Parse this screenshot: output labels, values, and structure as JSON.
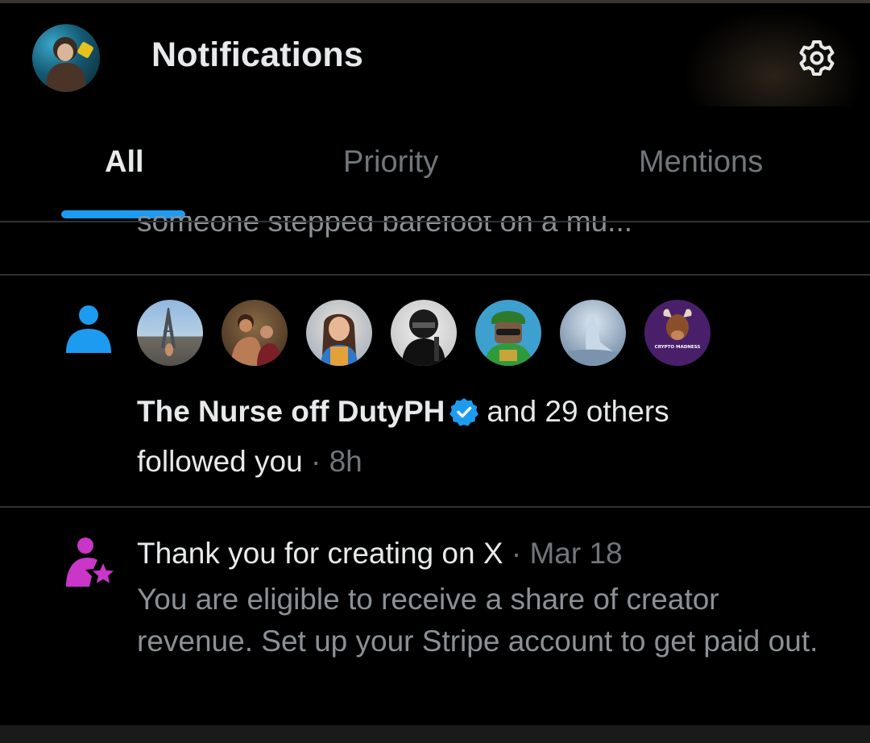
{
  "header": {
    "title": "Notifications",
    "avatar_icon": "profile-avatar",
    "settings_icon": "gear-icon"
  },
  "tabs": [
    {
      "label": "All",
      "active": true
    },
    {
      "label": "Priority",
      "active": false
    },
    {
      "label": "Mentions",
      "active": false
    }
  ],
  "colors": {
    "accent": "#1d9bf0",
    "creator": "#c936c8",
    "background": "#000000"
  },
  "truncated_item": {
    "text": "someone stepped barefoot on a mu..."
  },
  "follow_notification": {
    "icon": "person-icon",
    "follower_name": "The Nurse off DutyPH",
    "verified": true,
    "others_text": "and 29 others",
    "action": "followed you",
    "separator": "·",
    "time": "8h",
    "avatar_count": 7,
    "last_avatar_caption": "CRYPTO MADNESS"
  },
  "creator_notification": {
    "icon": "creator-star-icon",
    "title": "Thank you for creating on X",
    "separator": "·",
    "date": "Mar 18",
    "body": "You are eligible to receive a share of creator revenue. Set up your Stripe account to get paid out."
  }
}
